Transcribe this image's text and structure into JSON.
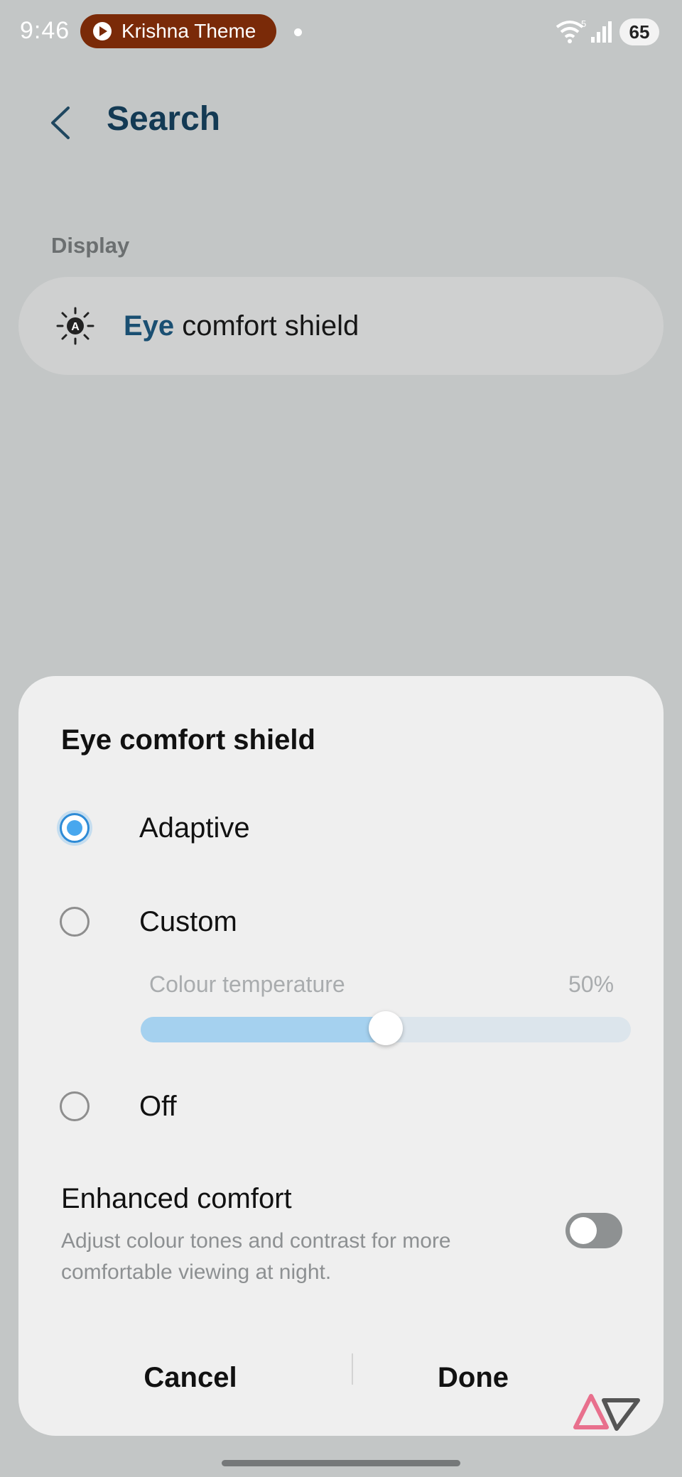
{
  "status_bar": {
    "time": "9:46",
    "media_title": "Krishna Theme",
    "wifi_badge": "5",
    "battery": "65"
  },
  "header": {
    "title": "Search"
  },
  "section": {
    "label": "Display"
  },
  "result": {
    "highlight": "Eye",
    "rest": " comfort shield"
  },
  "sheet": {
    "title": "Eye comfort shield",
    "options": [
      {
        "label": "Adaptive",
        "selected": true
      },
      {
        "label": "Custom",
        "selected": false
      },
      {
        "label": "Off",
        "selected": false
      }
    ],
    "slider": {
      "label": "Colour temperature",
      "value_text": "50%",
      "fraction": 0.5
    },
    "enhanced": {
      "title": "Enhanced comfort",
      "description": "Adjust colour tones and contrast for more comfortable viewing at night.",
      "enabled": false
    },
    "cancel_label": "Cancel",
    "done_label": "Done"
  },
  "colors": {
    "accent": "#48a7ee",
    "title_blue": "#133a54",
    "media_pill": "#7a2a08"
  },
  "icons": [
    "back-chevron-icon",
    "eye-comfort-sun-icon",
    "wifi-icon",
    "signal-icon",
    "play-icon"
  ]
}
